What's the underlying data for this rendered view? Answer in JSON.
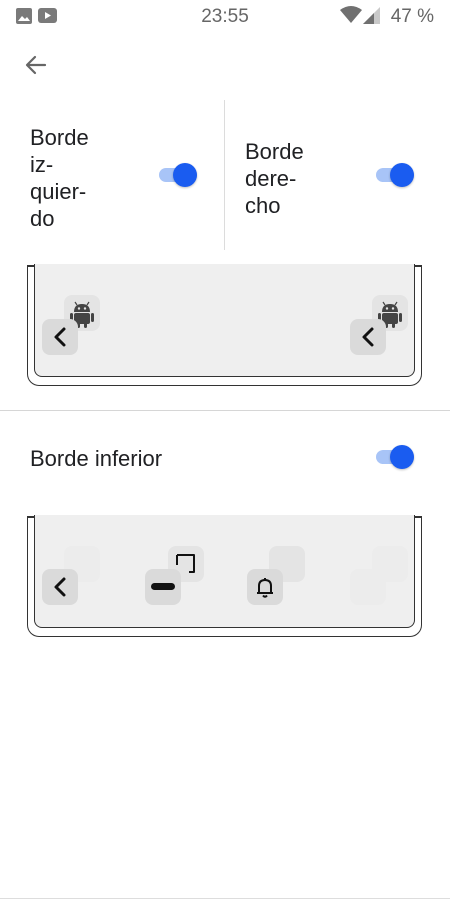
{
  "status_bar": {
    "time": "23:55",
    "battery_percent": "47 %",
    "left_icons": [
      "image-icon",
      "youtube-icon"
    ],
    "right_icons": [
      "wifi-icon",
      "cellular-signal-icon"
    ]
  },
  "back_icon": "arrow-left-icon",
  "left_edge": {
    "label_lines": [
      "Borde",
      "iz-",
      "quier-",
      "do"
    ],
    "enabled": true
  },
  "right_edge": {
    "label_lines": [
      "Borde",
      "dere-",
      "cho"
    ],
    "enabled": true
  },
  "bottom_edge": {
    "label": "Borde inferior",
    "enabled": true
  },
  "colors": {
    "accent": "#1a5cf0",
    "track": "#a8c4f7"
  }
}
